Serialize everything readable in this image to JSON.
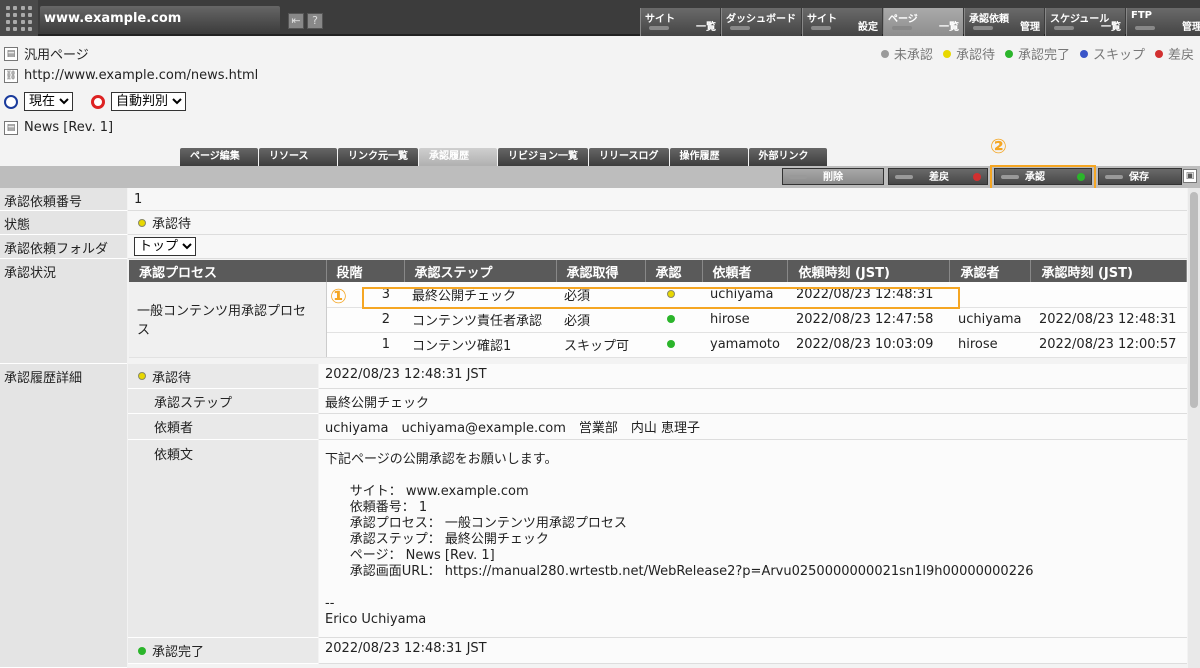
{
  "header": {
    "host": "www.example.com",
    "nav": [
      {
        "top": "サイト",
        "bottom": "一覧"
      },
      {
        "top": "ダッシュボード",
        "bottom": ""
      },
      {
        "top": "サイト",
        "bottom": "設定"
      },
      {
        "top": "ページ",
        "bottom": "一覧"
      },
      {
        "top": "承認依頼",
        "bottom": "管理"
      },
      {
        "top": "スケジュール",
        "bottom": "一覧"
      },
      {
        "top": "FTP",
        "bottom": "管理"
      }
    ]
  },
  "page_info": {
    "type": "汎用ページ",
    "url": "http://www.example.com/news.html",
    "time_select": "現在",
    "judge_select": "自動判別",
    "title": "News [Rev. 1]"
  },
  "legend": [
    {
      "label": "未承認",
      "color": "#9a9a9a"
    },
    {
      "label": "承認待",
      "color": "#e8d800"
    },
    {
      "label": "承認完了",
      "color": "#2bb52b"
    },
    {
      "label": "スキップ",
      "color": "#3a55c8"
    },
    {
      "label": "差戻",
      "color": "#d23030"
    }
  ],
  "tabs": [
    "ページ編集",
    "リソース",
    "リンク元一覧",
    "承認履歴",
    "リビジョン一覧",
    "リリースログ",
    "操作履歴",
    "外部リンク"
  ],
  "actions": {
    "delete": "削除",
    "reject": "差戻",
    "approve": "承認",
    "save": "保存"
  },
  "callouts": {
    "one": "①",
    "two": "②"
  },
  "fields": {
    "request_no_label": "承認依頼番号",
    "request_no": "1",
    "status_label": "状態",
    "status": "承認待",
    "folder_label": "承認依頼フォルダ",
    "folder": "トップ",
    "approval_status_label": "承認状況",
    "history_label": "承認履歴詳細"
  },
  "approval_table": {
    "headers": [
      "承認プロセス",
      "段階",
      "承認ステップ",
      "承認取得",
      "承認",
      "依頼者",
      "依頼時刻 (JST)",
      "承認者",
      "承認時刻 (JST)"
    ],
    "process": "一般コンテンツ用承認プロセス",
    "rows": [
      {
        "stage": "3",
        "step": "最終公開チェック",
        "req": "必須",
        "dot": "#e8d800",
        "requester": "uchiyama",
        "req_time": "2022/08/23 12:48:31",
        "approver": "",
        "app_time": ""
      },
      {
        "stage": "2",
        "step": "コンテンツ責任者承認",
        "req": "必須",
        "dot": "#2bb52b",
        "requester": "hirose",
        "req_time": "2022/08/23 12:47:58",
        "approver": "uchiyama",
        "app_time": "2022/08/23 12:48:31"
      },
      {
        "stage": "1",
        "step": "コンテンツ確認1",
        "req": "スキップ可",
        "dot": "#2bb52b",
        "requester": "yamamoto",
        "req_time": "2022/08/23 10:03:09",
        "approver": "hirose",
        "app_time": "2022/08/23 12:00:57"
      }
    ]
  },
  "history": {
    "status1": "承認待",
    "status1_time": "2022/08/23 12:48:31 JST",
    "step_label": "承認ステップ",
    "step": "最終公開チェック",
    "requester_label": "依頼者",
    "requester": "uchiyama　uchiyama@example.com　営業部　内山 恵理子",
    "message_label": "依頼文",
    "message": "下記ページの公開承認をお願いします。\n\n      サイト： www.example.com\n      依頼番号： 1\n      承認プロセス： 一般コンテンツ用承認プロセス\n      承認ステップ： 最終公開チェック\n      ページ： News [Rev. 1]\n      承認画面URL： https://manual280.wrtestb.net/WebRelease2?p=Arvu0250000000021sn1l9h00000000226\n\n--\nErico Uchiyama",
    "status2": "承認完了",
    "status2_time": "2022/08/23 12:48:31 JST"
  }
}
